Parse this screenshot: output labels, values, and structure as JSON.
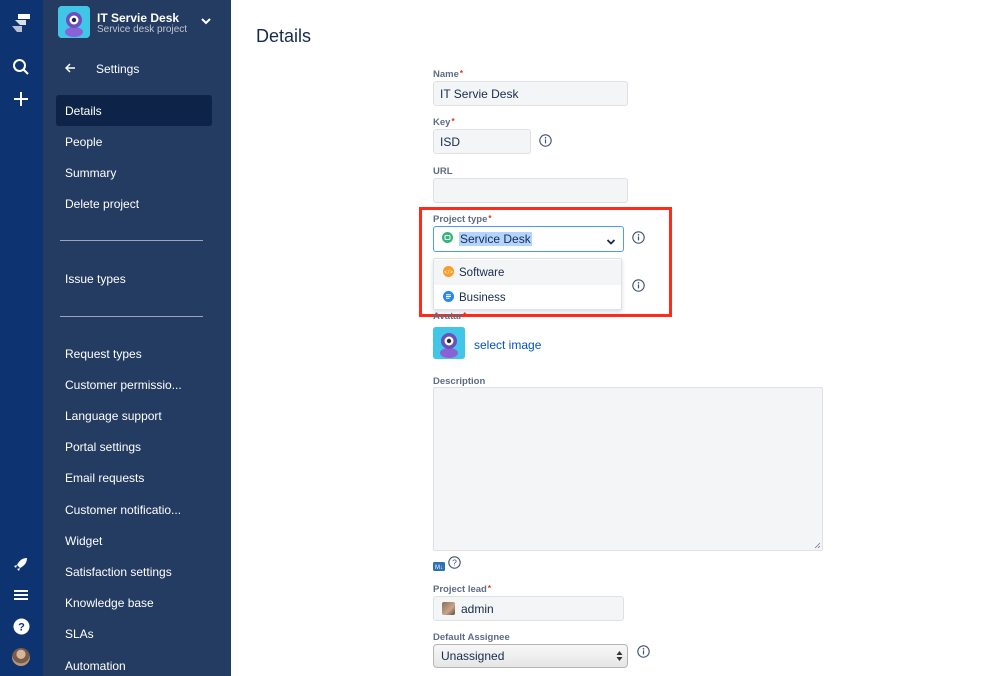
{
  "sidebar": {
    "project_name": "IT Servie Desk",
    "project_subtitle": "Service desk project",
    "back_label": "Settings",
    "items": [
      {
        "label": "Details"
      },
      {
        "label": "People"
      },
      {
        "label": "Summary"
      },
      {
        "label": "Delete project"
      },
      {
        "label": "Issue types"
      },
      {
        "label": "Request types"
      },
      {
        "label": "Customer permissio..."
      },
      {
        "label": "Language support"
      },
      {
        "label": "Portal settings"
      },
      {
        "label": "Email requests"
      },
      {
        "label": "Customer notificatio..."
      },
      {
        "label": "Widget"
      },
      {
        "label": "Satisfaction settings"
      },
      {
        "label": "Knowledge base"
      },
      {
        "label": "SLAs"
      },
      {
        "label": "Automation"
      }
    ]
  },
  "main": {
    "title": "Details",
    "fields": {
      "name_label": "Name",
      "name_value": "IT Servie Desk",
      "key_label": "Key",
      "key_value": "ISD",
      "url_label": "URL",
      "url_value": "",
      "project_type_label": "Project type",
      "project_type_value": "Service Desk",
      "project_type_options": [
        {
          "label": "Software",
          "color": "#ff991f"
        },
        {
          "label": "Business",
          "color": "#2684ff"
        }
      ],
      "avatar_label": "Avatar",
      "select_image_link": "select image",
      "description_label": "Description",
      "project_lead_label": "Project lead",
      "project_lead_value": "admin",
      "default_assignee_label": "Default Assignee",
      "default_assignee_value": "Unassigned"
    }
  },
  "colors": {
    "nav_rail": "#0d3470",
    "sidebar": "#243b62",
    "sidebar_active": "#0d2448",
    "service_desk_green": "#36b37e",
    "highlight_red": "#ff2a1a",
    "link_blue": "#0052cc"
  }
}
